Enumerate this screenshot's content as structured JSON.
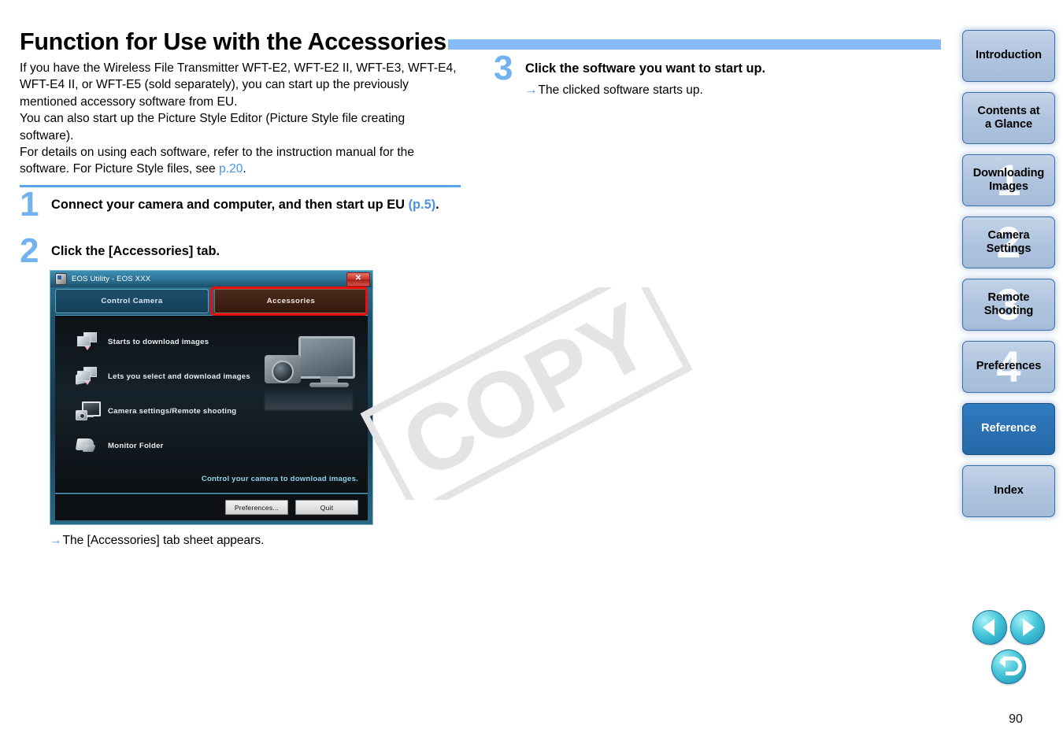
{
  "page": {
    "title": "Function for Use with the Accessories",
    "number": "90"
  },
  "watermark": {
    "text": "COPY"
  },
  "intro": {
    "line1_a": "If you have the Wireless File Transmitter WFT-E2, WFT-E2 II, WFT-E3, WFT-E4, WFT-E4 II, or WFT-E5 (sold separately), you can start up the previously mentioned accessory software from EU.",
    "line2": "You can also start up the Picture Style Editor (Picture Style file creating software).",
    "line3_a": "For details on using each software, refer to the instruction manual for the software. For Picture Style files, see ",
    "line3_link": "p.20",
    "line3_b": "."
  },
  "steps": [
    {
      "number": "1",
      "heading_a": "Connect your camera and computer, and then start up EU ",
      "heading_link": "(p.5)",
      "heading_b": "."
    },
    {
      "number": "2",
      "heading": "Click the [Accessories] tab.",
      "result_arrow": "→",
      "result": "The [Accessories] tab sheet appears."
    },
    {
      "number": "3",
      "heading": "Click the software you want to start up.",
      "result_arrow": "→",
      "result": "The clicked software starts up."
    }
  ],
  "eos_dialog": {
    "title": "EOS Utility -  EOS XXX",
    "close_label": "✕",
    "tabs": [
      {
        "label": "Control Camera",
        "active": false
      },
      {
        "label": "Accessories",
        "active": true
      }
    ],
    "items": [
      {
        "icon": "download-images-icon",
        "label": "Starts to download images"
      },
      {
        "icon": "select-download-images-icon",
        "label": "Lets you select and download images"
      },
      {
        "icon": "camera-remote-shooting-icon",
        "label": "Camera settings/Remote shooting"
      },
      {
        "icon": "monitor-folder-icon",
        "label": "Monitor Folder"
      }
    ],
    "tagline": "Control your camera to download images.",
    "buttons": [
      {
        "label": "Preferences..."
      },
      {
        "label": "Quit"
      }
    ]
  },
  "sidebar": {
    "items": [
      {
        "label": "Introduction",
        "ghost": "",
        "active": false
      },
      {
        "label": "Contents at\na Glance",
        "ghost": "",
        "active": false
      },
      {
        "label": "Downloading\nImages",
        "ghost": "1",
        "active": false
      },
      {
        "label": "Camera\nSettings",
        "ghost": "2",
        "active": false
      },
      {
        "label": "Remote\nShooting",
        "ghost": "3",
        "active": false
      },
      {
        "label": "Preferences",
        "ghost": "4",
        "active": false
      },
      {
        "label": "Reference",
        "ghost": "",
        "active": true
      },
      {
        "label": "Index",
        "ghost": "",
        "active": false
      }
    ]
  },
  "nav_arrows": [
    {
      "name": "previous-page-button"
    },
    {
      "name": "next-page-button"
    },
    {
      "name": "back-button"
    }
  ],
  "colors": {
    "accent_blue": "#86bbf5",
    "link_blue": "#4a93e8",
    "step_number_blue": "#72b2ef",
    "rule_blue": "#5ba3f2",
    "sidebar_active": "#2a6fb0",
    "sidebar_inactive": "#aec3de",
    "highlight_red": "#ef0c0c",
    "nav_circle": "#46c6d8"
  }
}
